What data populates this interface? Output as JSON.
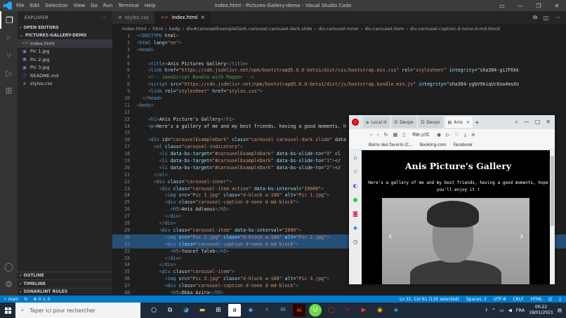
{
  "window": {
    "title": "index.html - Pictures-Gallery-demo - Visual Studio Code",
    "menu": [
      "File",
      "Edit",
      "Selection",
      "View",
      "Go",
      "Run",
      "Terminal",
      "Help"
    ]
  },
  "sidebar": {
    "header": "EXPLORER",
    "open_editors": "OPEN EDITORS",
    "project": "PICTURES-GALLERY-DEMO",
    "files": [
      {
        "name": "index.html",
        "icon": "<>"
      },
      {
        "name": "Pic 1.jpg",
        "icon": "▣"
      },
      {
        "name": "Pic 2.jpg",
        "icon": "▣"
      },
      {
        "name": "Pic 3.jpg",
        "icon": "▣"
      },
      {
        "name": "README.md",
        "icon": "ⓘ"
      },
      {
        "name": "styles.css",
        "icon": "#"
      }
    ],
    "bottom_sections": [
      "OUTLINE",
      "TIMELINE",
      "SONARLINT RULES"
    ]
  },
  "tabs": [
    {
      "label": "styles.css",
      "icon": "#"
    },
    {
      "label": "index.html",
      "icon": "<>"
    }
  ],
  "breadcrumb": [
    "index.html",
    "html",
    "body",
    "div#carouselExampleDark.carousel.carousel-dark.slide",
    "div.carousel-inner",
    "div.carousel-item",
    "div.carousel-caption.d-none.d-md-block"
  ],
  "code_lines": [
    {
      "n": "1",
      "text": "<!DOCTYPE html>"
    },
    {
      "n": "2",
      "text": "<html lang=\"en\">"
    },
    {
      "n": "3",
      "text": "<head>"
    },
    {
      "n": "4",
      "text": ""
    },
    {
      "n": "5",
      "text": "    <title>Anis Pictures Gallery</title>"
    },
    {
      "n": "6",
      "text": "    <link href=\"https://cdn.jsdelivr.net/npm/bootstrap@5.0.0-beta1/dist/css/bootstrap.min.css\" rel=\"stylesheet\" integrity=\"sha384-giJF6kk"
    },
    {
      "n": "7",
      "text": "    <!-- JavaScript Bundle with Popper -->"
    },
    {
      "n": "8",
      "text": "    <script src=\"https://cdn.jsdelivr.net/npm/bootstrap@5.0.0-beta1/dist/js/bootstrap.bundle.min.js\" integrity=\"sha384-ygbV9kiqUc6oa4msXn"
    },
    {
      "n": "9",
      "text": "    <link rel=\"stylesheet\" href=\"styles.css\">"
    },
    {
      "n": "10",
      "text": "  </head>"
    },
    {
      "n": "11",
      "text": "<body>"
    },
    {
      "n": "12",
      "text": ""
    },
    {
      "n": "13",
      "text": "    <h1>Anis Picture's Gallery</h1>"
    },
    {
      "n": "14",
      "text": "    <p>Here's a gallery of me and my best friends, having a good moments, h"
    },
    {
      "n": "15",
      "text": ""
    },
    {
      "n": "16",
      "text": "    <div id=\"carouselExampleDark\" class=\"carousel carousel-dark slide\" data"
    },
    {
      "n": "17",
      "text": "      <ol class=\"carousel-indicators\">"
    },
    {
      "n": "18",
      "text": "        <li data-bs-target=\"#carouselExampleDark\" data-bs-slide-to=\"0\" cl"
    },
    {
      "n": "19",
      "text": "        <li data-bs-target=\"#carouselExampleDark\" data-bs-slide-to=\"1\"></"
    },
    {
      "n": "20",
      "text": "        <li data-bs-target=\"#carouselExampleDark\" data-bs-slide-to=\"2\"></"
    },
    {
      "n": "21",
      "text": "      </ol>"
    },
    {
      "n": "22",
      "text": "      <div class=\"carousel-inner\">"
    },
    {
      "n": "23",
      "text": "        <div class=\"carousel-item active\" data-bs-interval=\"10000\">"
    },
    {
      "n": "24",
      "text": "          <img src=\"Pic 1.jpg\" class=\"d-block w-100\" alt=\"Pic 1.jpg\">"
    },
    {
      "n": "25",
      "text": "          <div class=\"carousel-caption d-none d-md-block\">"
    },
    {
      "n": "26",
      "text": "            <h5>Anis Adlaoui</h5>"
    },
    {
      "n": "27",
      "text": "          </div>"
    },
    {
      "n": "28",
      "text": "        </div>"
    },
    {
      "n": "29",
      "text": "        <div class=\"carousel-item\" data-bs-interval=\"2000\">"
    },
    {
      "n": "30",
      "text": "          <img src=\"Pic 2.jpg\" class=\"d-block w-100\" alt=\"Pic 2.jpg\">"
    },
    {
      "n": "31",
      "text": "          <div class=\"carousel-caption d-none d-md-block\">"
    },
    {
      "n": "32",
      "text": "            <h5>Youcef Taleb</h5>"
    },
    {
      "n": "33",
      "text": "          </div>"
    },
    {
      "n": "34",
      "text": "        </div>"
    },
    {
      "n": "35",
      "text": "        <div class=\"carousel-item\">"
    },
    {
      "n": "36",
      "text": "          <img src=\"Pic 3.jpg\" class=\"d-block w-100\" alt=\"Pic 3.jpg\">"
    },
    {
      "n": "37",
      "text": "          <div class=\"carousel-caption d-none d-md-block\">"
    },
    {
      "n": "38",
      "text": "            <h5>Okba Azira</h5>"
    }
  ],
  "statusbar": {
    "branch": "main",
    "problems": "⊗ 0 ⚠ 0",
    "right": [
      "Ln 31, Col 61 (135 selected)",
      "Spaces: 2",
      "UTF-8",
      "CRLF",
      "HTML"
    ]
  },
  "browser": {
    "tabs": [
      "Local H",
      "Devpo",
      "Devpo",
      "Anis"
    ],
    "address": "file:///C",
    "bookmarks": [
      "Barre des favoris (C...",
      "Booking.com",
      "Facebook"
    ],
    "page_title": "Anis Picture's Gallery",
    "page_text": "Here's a gallery of me and my best friends, having a good moments, hope you'll enjoy it !",
    "prev": "‹",
    "next": "›"
  },
  "taskbar": {
    "search_placeholder": "Taper ici pour rechercher",
    "lang": "FRA",
    "time": "00:22",
    "date": "18/01/2021"
  }
}
